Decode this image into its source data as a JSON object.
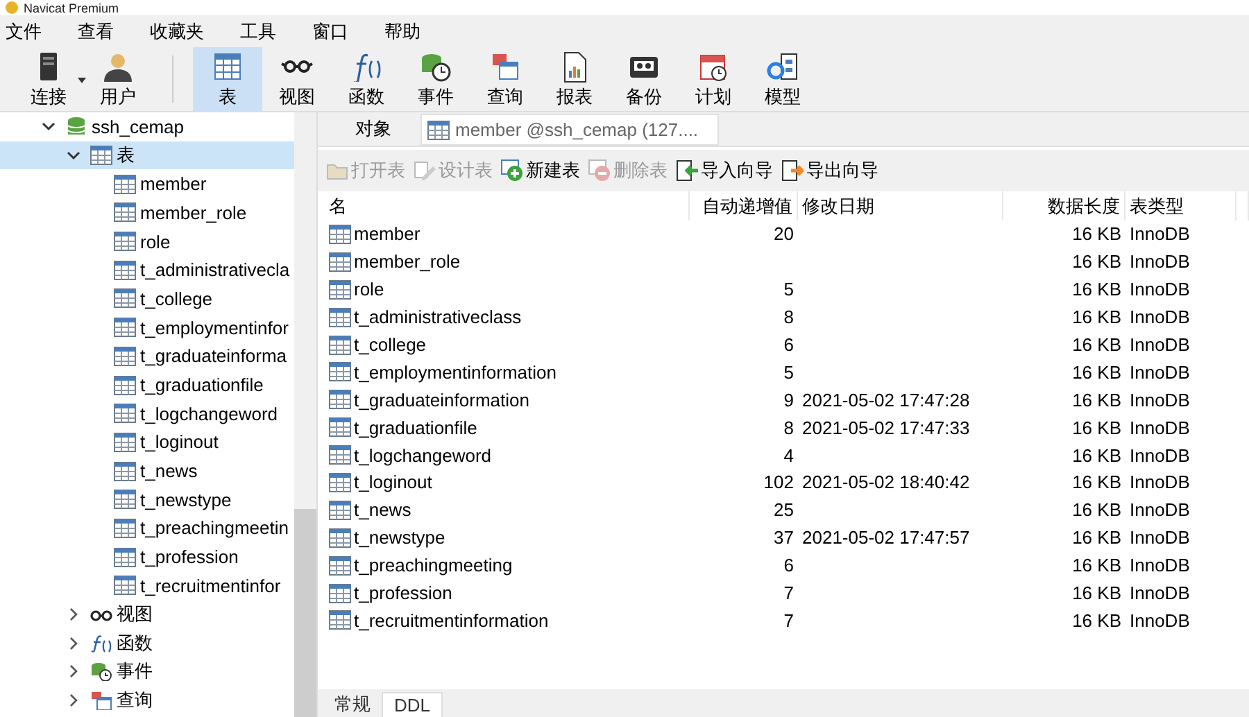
{
  "window": {
    "title": "Navicat Premium"
  },
  "menu": [
    "文件",
    "查看",
    "收藏夹",
    "工具",
    "窗口",
    "帮助"
  ],
  "toolbar": [
    {
      "label": "连接",
      "selected": false,
      "dropdown": true
    },
    {
      "label": "用户",
      "selected": false
    },
    {
      "label": "表",
      "selected": true
    },
    {
      "label": "视图",
      "selected": false
    },
    {
      "label": "函数",
      "selected": false
    },
    {
      "label": "事件",
      "selected": false
    },
    {
      "label": "查询",
      "selected": false
    },
    {
      "label": "报表",
      "selected": false
    },
    {
      "label": "备份",
      "selected": false
    },
    {
      "label": "计划",
      "selected": false
    },
    {
      "label": "模型",
      "selected": false
    }
  ],
  "sidebar": {
    "items": [
      {
        "label": "ssh_cemap",
        "kind": "database",
        "expanded": true,
        "selected": false,
        "children": [
          {
            "label": "表",
            "kind": "tables",
            "expanded": true,
            "selected": true,
            "children": [
              {
                "label": "member",
                "kind": "table"
              },
              {
                "label": "member_role",
                "kind": "table"
              },
              {
                "label": "role",
                "kind": "table"
              },
              {
                "label": "t_administrativecla",
                "kind": "table"
              },
              {
                "label": "t_college",
                "kind": "table"
              },
              {
                "label": "t_employmentinfor",
                "kind": "table"
              },
              {
                "label": "t_graduateinforma",
                "kind": "table"
              },
              {
                "label": "t_graduationfile",
                "kind": "table"
              },
              {
                "label": "t_logchangeword",
                "kind": "table"
              },
              {
                "label": "t_loginout",
                "kind": "table"
              },
              {
                "label": "t_news",
                "kind": "table"
              },
              {
                "label": "t_newstype",
                "kind": "table"
              },
              {
                "label": "t_preachingmeetin",
                "kind": "table"
              },
              {
                "label": "t_profession",
                "kind": "table"
              },
              {
                "label": "t_recruitmentinfor",
                "kind": "table"
              }
            ]
          },
          {
            "label": "视图",
            "kind": "views",
            "expanded": false,
            "selected": false
          },
          {
            "label": "函数",
            "kind": "functions",
            "expanded": false,
            "selected": false
          },
          {
            "label": "事件",
            "kind": "events",
            "expanded": false,
            "selected": false
          },
          {
            "label": "查询",
            "kind": "queries",
            "expanded": false,
            "selected": false
          }
        ]
      }
    ]
  },
  "tabs": [
    {
      "label": "对象",
      "selected": true
    },
    {
      "label": "member @ssh_cemap (127....",
      "selected": false
    }
  ],
  "object_toolbar": [
    {
      "label": "打开表",
      "disabled": true
    },
    {
      "label": "设计表",
      "disabled": true
    },
    {
      "label": "新建表",
      "disabled": false
    },
    {
      "label": "删除表",
      "disabled": true
    },
    {
      "label": "导入向导",
      "disabled": false
    },
    {
      "label": "导出向导",
      "disabled": false
    }
  ],
  "table": {
    "columns": [
      "名",
      "自动递增值",
      "修改日期",
      "数据长度",
      "表类型"
    ],
    "rows": [
      {
        "name": "member",
        "auto_increment": "20",
        "size": "16 KB",
        "type": "InnoDB"
      },
      {
        "name": "member_role",
        "size": "16 KB",
        "type": "InnoDB"
      },
      {
        "name": "role",
        "auto_increment": "5",
        "size": "16 KB",
        "type": "InnoDB"
      },
      {
        "name": "t_administrativeclass",
        "auto_increment": "8",
        "size": "16 KB",
        "type": "InnoDB"
      },
      {
        "name": "t_college",
        "auto_increment": "6",
        "size": "16 KB",
        "type": "InnoDB"
      },
      {
        "name": "t_employmentinformation",
        "auto_increment": "5",
        "size": "16 KB",
        "type": "InnoDB"
      },
      {
        "name": "t_graduateinformation",
        "auto_increment": "9",
        "modified": "2021-05-02 17:47:28",
        "size": "16 KB",
        "type": "InnoDB"
      },
      {
        "name": "t_graduationfile",
        "auto_increment": "8",
        "modified": "2021-05-02 17:47:33",
        "size": "16 KB",
        "type": "InnoDB"
      },
      {
        "name": "t_logchangeword",
        "auto_increment": "4",
        "size": "16 KB",
        "type": "InnoDB"
      },
      {
        "name": "t_loginout",
        "auto_increment": "102",
        "modified": "2021-05-02 18:40:42",
        "size": "16 KB",
        "type": "InnoDB"
      },
      {
        "name": "t_news",
        "auto_increment": "25",
        "size": "16 KB",
        "type": "InnoDB"
      },
      {
        "name": "t_newstype",
        "auto_increment": "37",
        "modified": "2021-05-02 17:47:57",
        "size": "16 KB",
        "type": "InnoDB"
      },
      {
        "name": "t_preachingmeeting",
        "auto_increment": "6",
        "size": "16 KB",
        "type": "InnoDB"
      },
      {
        "name": "t_profession",
        "auto_increment": "7",
        "size": "16 KB",
        "type": "InnoDB"
      },
      {
        "name": "t_recruitmentinformation",
        "auto_increment": "7",
        "size": "16 KB",
        "type": "InnoDB"
      }
    ]
  },
  "bottom_tabs": [
    {
      "label": "常规",
      "selected": false
    },
    {
      "label": "DDL",
      "selected": true
    }
  ]
}
